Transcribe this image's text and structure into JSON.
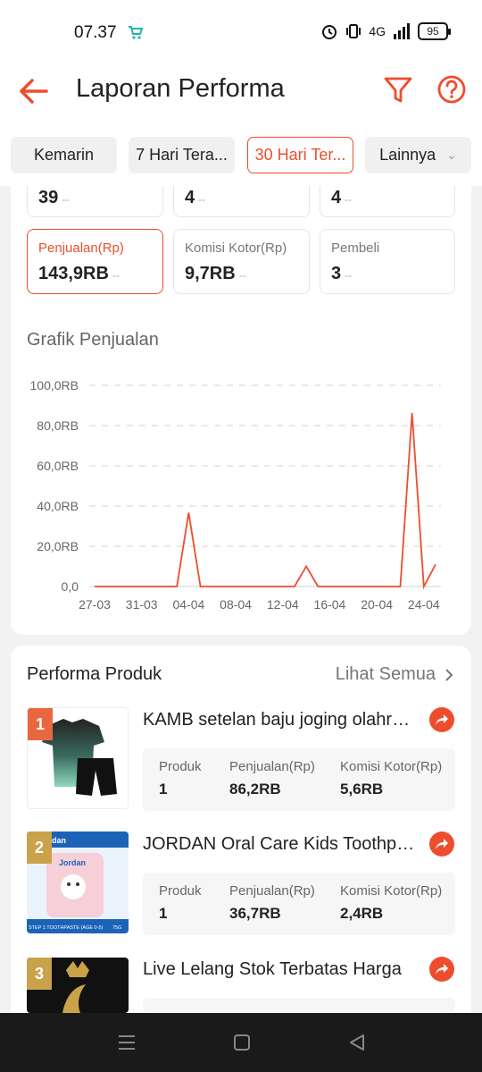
{
  "status_bar": {
    "time": "07.37",
    "battery": "95",
    "network": "4G"
  },
  "header": {
    "title": "Laporan Performa"
  },
  "tabs": [
    {
      "label": "Kemarin",
      "active": false
    },
    {
      "label": "7 Hari Tera...",
      "active": false
    },
    {
      "label": "30 Hari Ter...",
      "active": true
    },
    {
      "label": "Lainnya",
      "active": false
    }
  ],
  "metrics_top": [
    {
      "value": "39"
    },
    {
      "value": "4"
    },
    {
      "value": "4"
    }
  ],
  "metrics": [
    {
      "label": "Penjualan(Rp)",
      "value": "143,9RB",
      "active": true
    },
    {
      "label": "Komisi Kotor(Rp)",
      "value": "9,7RB",
      "active": false
    },
    {
      "label": "Pembeli",
      "value": "3",
      "active": false
    }
  ],
  "metric_dash": "--",
  "chart_title": "Grafik Penjualan",
  "chart_data": {
    "type": "line",
    "title": "Grafik Penjualan",
    "yticks": [
      "0,0",
      "20,0RB",
      "40,0RB",
      "60,0RB",
      "80,0RB",
      "100,0RB"
    ],
    "ylim": [
      0,
      100
    ],
    "xticks": [
      "27-03",
      "31-03",
      "04-04",
      "08-04",
      "12-04",
      "16-04",
      "20-04",
      "24-04"
    ],
    "x": [
      "27-03",
      "28-03",
      "29-03",
      "30-03",
      "31-03",
      "01-04",
      "02-04",
      "03-04",
      "04-04",
      "05-04",
      "06-04",
      "07-04",
      "08-04",
      "09-04",
      "10-04",
      "11-04",
      "12-04",
      "13-04",
      "14-04",
      "15-04",
      "16-04",
      "17-04",
      "18-04",
      "19-04",
      "20-04",
      "21-04",
      "22-04",
      "23-04",
      "24-04",
      "25-04"
    ],
    "values": [
      0,
      0,
      0,
      0,
      0,
      0,
      0,
      0,
      36.7,
      0,
      0,
      0,
      0,
      0,
      0,
      0,
      0,
      0,
      10,
      0,
      0,
      0,
      0,
      0,
      0,
      0,
      0,
      86.2,
      0,
      11
    ],
    "color": "#ee4d2d",
    "grid": true
  },
  "products_section": {
    "title": "Performa Produk",
    "see_all": "Lihat Semua",
    "labels": {
      "produk": "Produk",
      "penjualan": "Penjualan(Rp)",
      "komisi": "Komisi Kotor(Rp)"
    },
    "items": [
      {
        "rank": "1",
        "name": "KAMB setelan baju joging olahraga",
        "produk": "1",
        "penjualan": "86,2RB",
        "komisi": "5,6RB",
        "badge_color": "#e9673f"
      },
      {
        "rank": "2",
        "name": "JORDAN Oral Care Kids Toothpaste",
        "produk": "1",
        "penjualan": "36,7RB",
        "komisi": "2,4RB",
        "badge_color": "#c9a24a"
      },
      {
        "rank": "3",
        "name": "Live Lelang Stok Terbatas Harga",
        "produk": "",
        "penjualan": "",
        "komisi": "",
        "badge_color": "#c9a24a"
      }
    ]
  },
  "product_image_text": {
    "brand": "Jordan",
    "tube_caption": "STEP 1 TOOTHPASTE (AGE 0-5)",
    "size": "75G"
  },
  "colors": {
    "accent": "#ee4d2d",
    "muted": "#777777"
  }
}
